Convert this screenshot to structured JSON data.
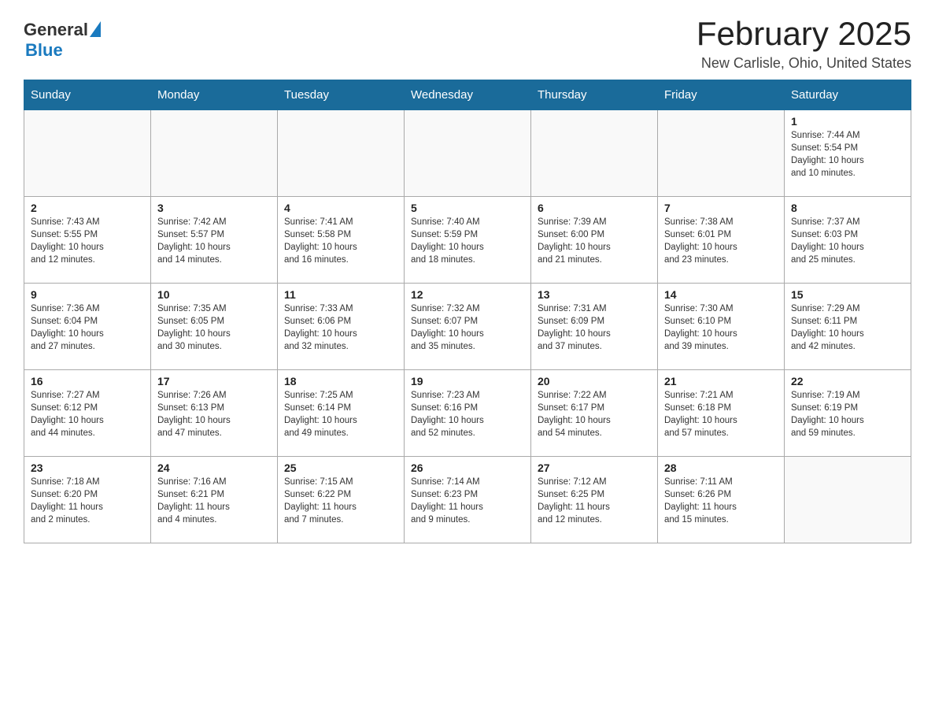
{
  "header": {
    "logo_general": "General",
    "logo_blue": "Blue",
    "month_title": "February 2025",
    "location": "New Carlisle, Ohio, United States"
  },
  "days_of_week": [
    "Sunday",
    "Monday",
    "Tuesday",
    "Wednesday",
    "Thursday",
    "Friday",
    "Saturday"
  ],
  "weeks": [
    {
      "cells": [
        {
          "day": null,
          "info": null
        },
        {
          "day": null,
          "info": null
        },
        {
          "day": null,
          "info": null
        },
        {
          "day": null,
          "info": null
        },
        {
          "day": null,
          "info": null
        },
        {
          "day": null,
          "info": null
        },
        {
          "day": "1",
          "info": "Sunrise: 7:44 AM\nSunset: 5:54 PM\nDaylight: 10 hours\nand 10 minutes."
        }
      ]
    },
    {
      "cells": [
        {
          "day": "2",
          "info": "Sunrise: 7:43 AM\nSunset: 5:55 PM\nDaylight: 10 hours\nand 12 minutes."
        },
        {
          "day": "3",
          "info": "Sunrise: 7:42 AM\nSunset: 5:57 PM\nDaylight: 10 hours\nand 14 minutes."
        },
        {
          "day": "4",
          "info": "Sunrise: 7:41 AM\nSunset: 5:58 PM\nDaylight: 10 hours\nand 16 minutes."
        },
        {
          "day": "5",
          "info": "Sunrise: 7:40 AM\nSunset: 5:59 PM\nDaylight: 10 hours\nand 18 minutes."
        },
        {
          "day": "6",
          "info": "Sunrise: 7:39 AM\nSunset: 6:00 PM\nDaylight: 10 hours\nand 21 minutes."
        },
        {
          "day": "7",
          "info": "Sunrise: 7:38 AM\nSunset: 6:01 PM\nDaylight: 10 hours\nand 23 minutes."
        },
        {
          "day": "8",
          "info": "Sunrise: 7:37 AM\nSunset: 6:03 PM\nDaylight: 10 hours\nand 25 minutes."
        }
      ]
    },
    {
      "cells": [
        {
          "day": "9",
          "info": "Sunrise: 7:36 AM\nSunset: 6:04 PM\nDaylight: 10 hours\nand 27 minutes."
        },
        {
          "day": "10",
          "info": "Sunrise: 7:35 AM\nSunset: 6:05 PM\nDaylight: 10 hours\nand 30 minutes."
        },
        {
          "day": "11",
          "info": "Sunrise: 7:33 AM\nSunset: 6:06 PM\nDaylight: 10 hours\nand 32 minutes."
        },
        {
          "day": "12",
          "info": "Sunrise: 7:32 AM\nSunset: 6:07 PM\nDaylight: 10 hours\nand 35 minutes."
        },
        {
          "day": "13",
          "info": "Sunrise: 7:31 AM\nSunset: 6:09 PM\nDaylight: 10 hours\nand 37 minutes."
        },
        {
          "day": "14",
          "info": "Sunrise: 7:30 AM\nSunset: 6:10 PM\nDaylight: 10 hours\nand 39 minutes."
        },
        {
          "day": "15",
          "info": "Sunrise: 7:29 AM\nSunset: 6:11 PM\nDaylight: 10 hours\nand 42 minutes."
        }
      ]
    },
    {
      "cells": [
        {
          "day": "16",
          "info": "Sunrise: 7:27 AM\nSunset: 6:12 PM\nDaylight: 10 hours\nand 44 minutes."
        },
        {
          "day": "17",
          "info": "Sunrise: 7:26 AM\nSunset: 6:13 PM\nDaylight: 10 hours\nand 47 minutes."
        },
        {
          "day": "18",
          "info": "Sunrise: 7:25 AM\nSunset: 6:14 PM\nDaylight: 10 hours\nand 49 minutes."
        },
        {
          "day": "19",
          "info": "Sunrise: 7:23 AM\nSunset: 6:16 PM\nDaylight: 10 hours\nand 52 minutes."
        },
        {
          "day": "20",
          "info": "Sunrise: 7:22 AM\nSunset: 6:17 PM\nDaylight: 10 hours\nand 54 minutes."
        },
        {
          "day": "21",
          "info": "Sunrise: 7:21 AM\nSunset: 6:18 PM\nDaylight: 10 hours\nand 57 minutes."
        },
        {
          "day": "22",
          "info": "Sunrise: 7:19 AM\nSunset: 6:19 PM\nDaylight: 10 hours\nand 59 minutes."
        }
      ]
    },
    {
      "cells": [
        {
          "day": "23",
          "info": "Sunrise: 7:18 AM\nSunset: 6:20 PM\nDaylight: 11 hours\nand 2 minutes."
        },
        {
          "day": "24",
          "info": "Sunrise: 7:16 AM\nSunset: 6:21 PM\nDaylight: 11 hours\nand 4 minutes."
        },
        {
          "day": "25",
          "info": "Sunrise: 7:15 AM\nSunset: 6:22 PM\nDaylight: 11 hours\nand 7 minutes."
        },
        {
          "day": "26",
          "info": "Sunrise: 7:14 AM\nSunset: 6:23 PM\nDaylight: 11 hours\nand 9 minutes."
        },
        {
          "day": "27",
          "info": "Sunrise: 7:12 AM\nSunset: 6:25 PM\nDaylight: 11 hours\nand 12 minutes."
        },
        {
          "day": "28",
          "info": "Sunrise: 7:11 AM\nSunset: 6:26 PM\nDaylight: 11 hours\nand 15 minutes."
        },
        {
          "day": null,
          "info": null
        }
      ]
    }
  ]
}
